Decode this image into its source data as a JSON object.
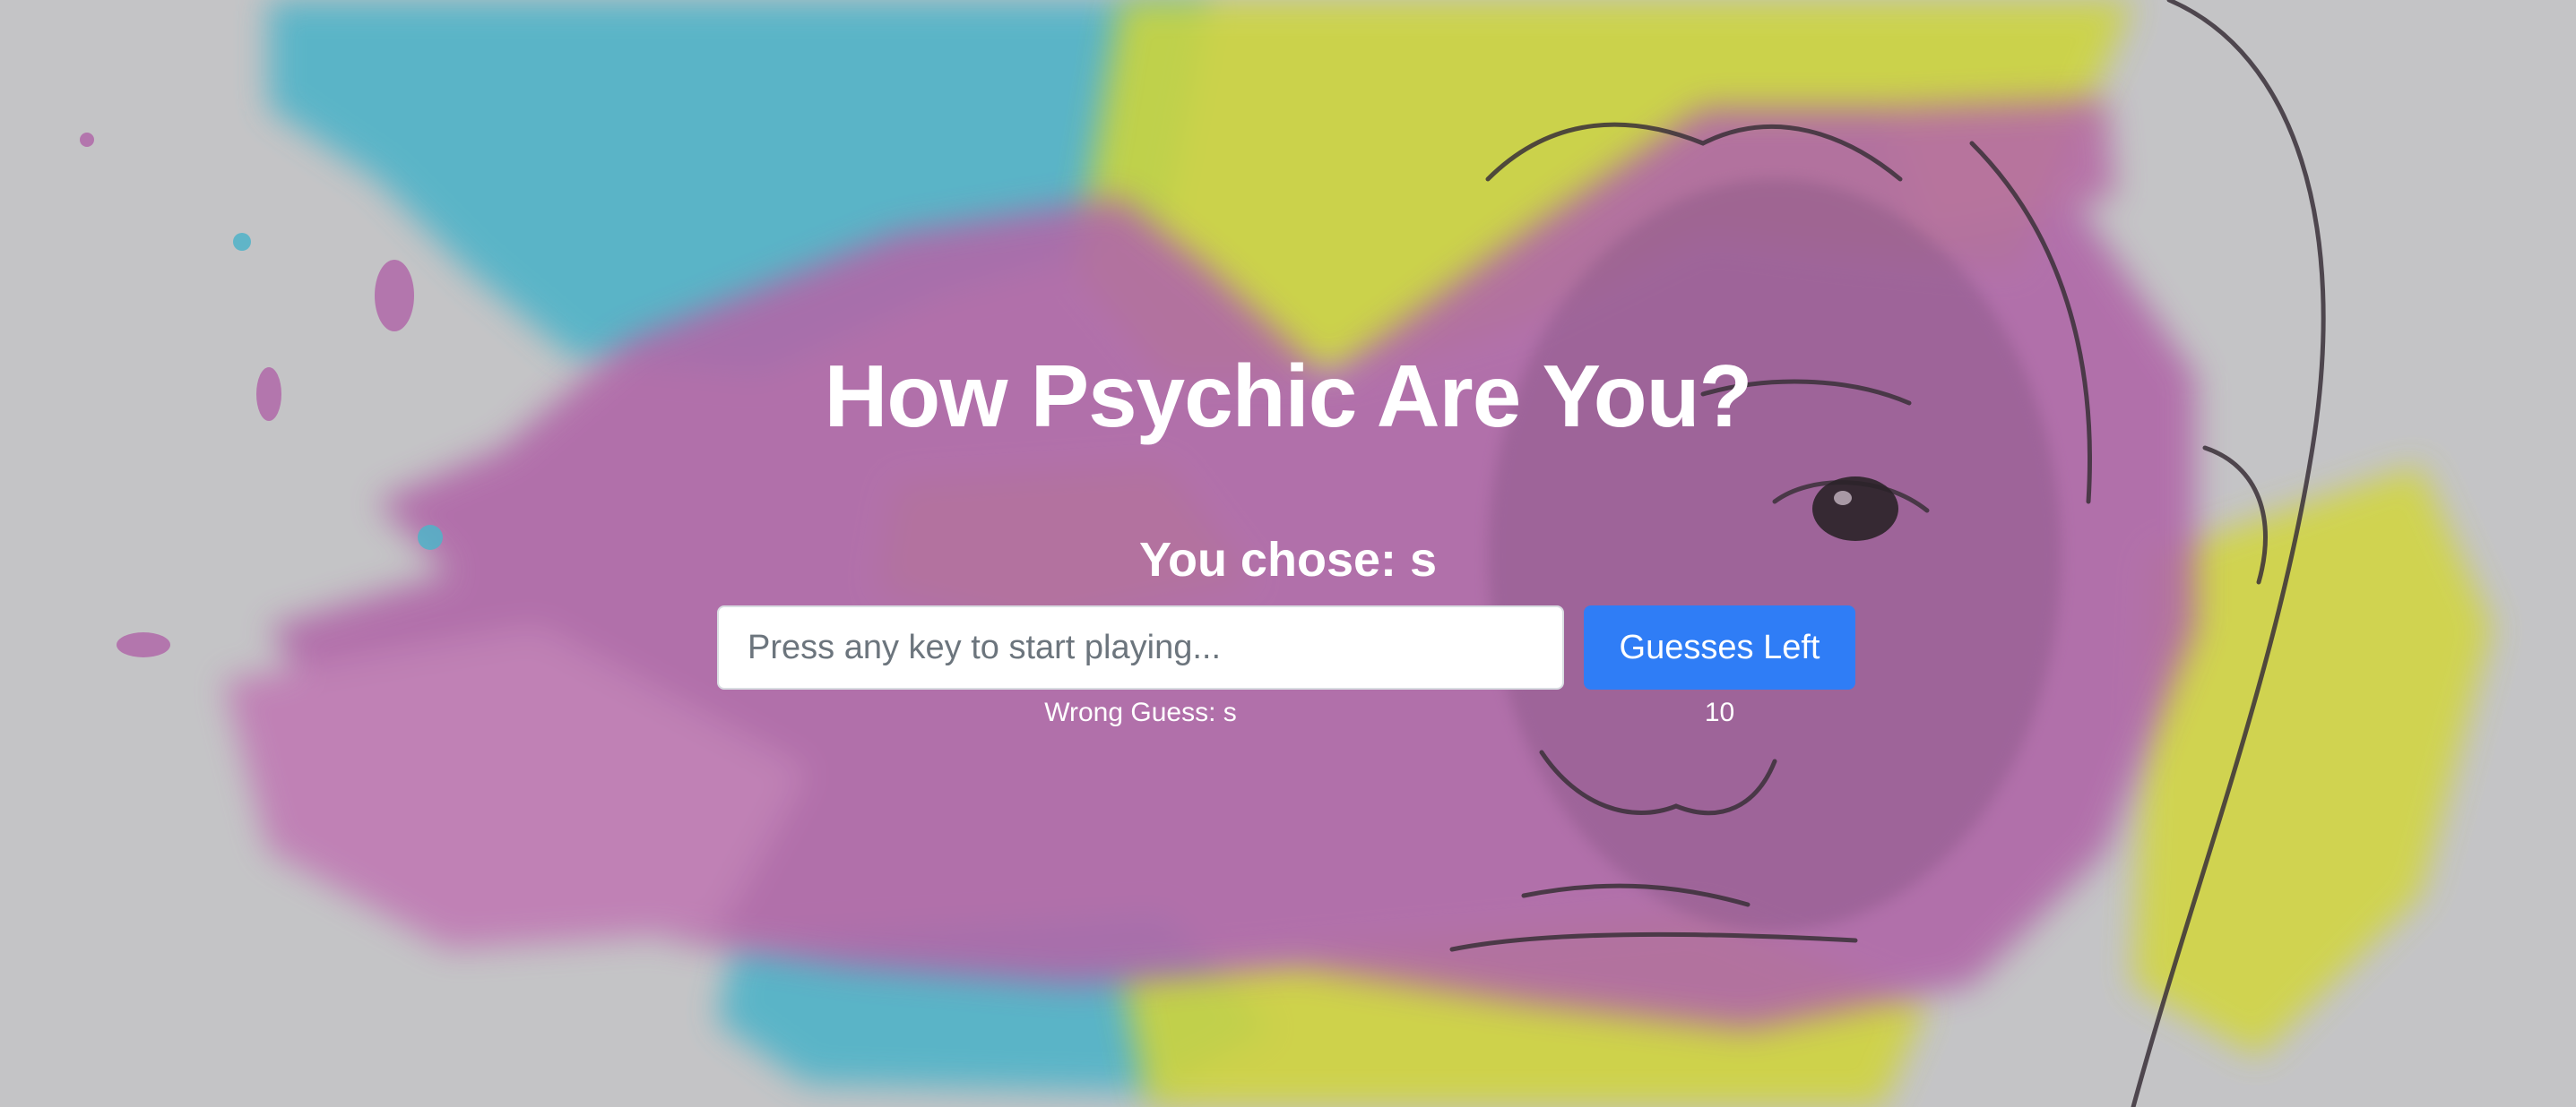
{
  "header": {
    "title": "How Psychic Are You?"
  },
  "game": {
    "chose_text": "You chose: s",
    "input_placeholder": "Press any key to start playing...",
    "input_value": "",
    "guesses_button_label": "Guesses Left",
    "wrong_guess_text": "Wrong Guess: s",
    "guesses_left": "10"
  },
  "background": {
    "description_icon": "watercolor-face-illustration",
    "colors": {
      "base_gray": "#c4c4c6",
      "cyan": "#4fb3c8",
      "magenta": "#b068a8",
      "yellow": "#d6d83a",
      "button_blue": "#2f7df6"
    }
  }
}
